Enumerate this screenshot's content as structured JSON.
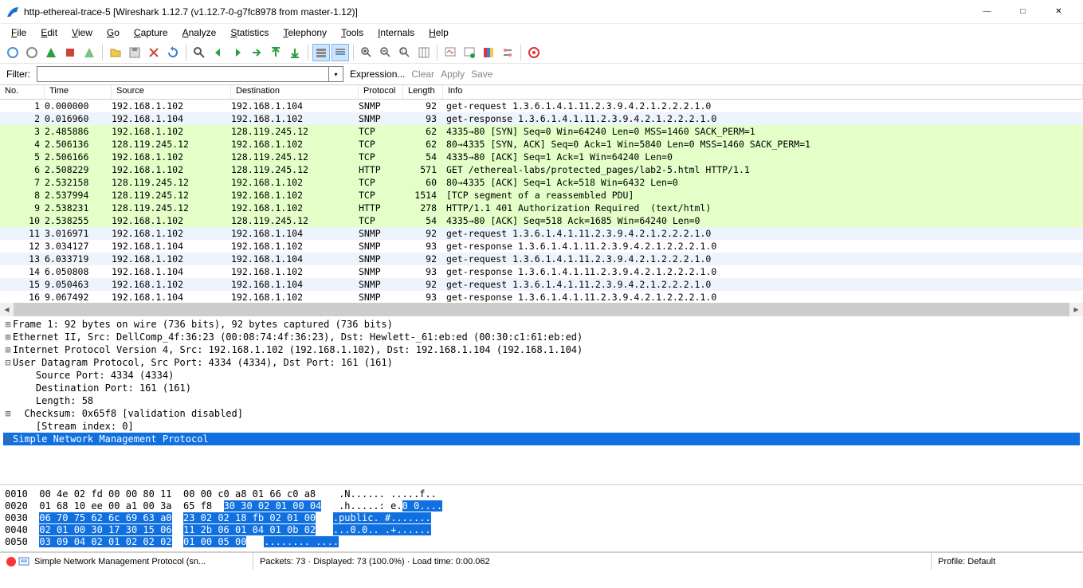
{
  "window": {
    "title": "http-ethereal-trace-5   [Wireshark 1.12.7  (v1.12.7-0-g7fc8978 from master-1.12)]"
  },
  "menu": {
    "items": [
      "File",
      "Edit",
      "View",
      "Go",
      "Capture",
      "Analyze",
      "Statistics",
      "Telephony",
      "Tools",
      "Internals",
      "Help"
    ]
  },
  "filter": {
    "label": "Filter:",
    "value": "",
    "expression": "Expression...",
    "clear": "Clear",
    "apply": "Apply",
    "save": "Save"
  },
  "columns": [
    "No.",
    "Time",
    "Source",
    "Destination",
    "Protocol",
    "Length",
    "Info"
  ],
  "packets": [
    {
      "no": "1",
      "time": "0.000000",
      "src": "192.168.1.102",
      "dst": "192.168.1.104",
      "proto": "SNMP",
      "len": "92",
      "info": "get-request 1.3.6.1.4.1.11.2.3.9.4.2.1.2.2.2.1.0",
      "cls": "snmp"
    },
    {
      "no": "2",
      "time": "0.016960",
      "src": "192.168.1.104",
      "dst": "192.168.1.102",
      "proto": "SNMP",
      "len": "93",
      "info": "get-response 1.3.6.1.4.1.11.2.3.9.4.2.1.2.2.2.1.0",
      "cls": "snmp alt"
    },
    {
      "no": "3",
      "time": "2.485886",
      "src": "192.168.1.102",
      "dst": "128.119.245.12",
      "proto": "TCP",
      "len": "62",
      "info": "4335→80 [SYN] Seq=0 Win=64240 Len=0 MSS=1460 SACK_PERM=1",
      "cls": "tcp"
    },
    {
      "no": "4",
      "time": "2.506136",
      "src": "128.119.245.12",
      "dst": "192.168.1.102",
      "proto": "TCP",
      "len": "62",
      "info": "80→4335 [SYN, ACK] Seq=0 Ack=1 Win=5840 Len=0 MSS=1460 SACK_PERM=1",
      "cls": "tcp"
    },
    {
      "no": "5",
      "time": "2.506166",
      "src": "192.168.1.102",
      "dst": "128.119.245.12",
      "proto": "TCP",
      "len": "54",
      "info": "4335→80 [ACK] Seq=1 Ack=1 Win=64240 Len=0",
      "cls": "tcp"
    },
    {
      "no": "6",
      "time": "2.508229",
      "src": "192.168.1.102",
      "dst": "128.119.245.12",
      "proto": "HTTP",
      "len": "571",
      "info": "GET /ethereal-labs/protected_pages/lab2-5.html HTTP/1.1",
      "cls": "http"
    },
    {
      "no": "7",
      "time": "2.532158",
      "src": "128.119.245.12",
      "dst": "192.168.1.102",
      "proto": "TCP",
      "len": "60",
      "info": "80→4335 [ACK] Seq=1 Ack=518 Win=6432 Len=0",
      "cls": "tcp"
    },
    {
      "no": "8",
      "time": "2.537994",
      "src": "128.119.245.12",
      "dst": "192.168.1.102",
      "proto": "TCP",
      "len": "1514",
      "info": "[TCP segment of a reassembled PDU]",
      "cls": "tcp"
    },
    {
      "no": "9",
      "time": "2.538231",
      "src": "128.119.245.12",
      "dst": "192.168.1.102",
      "proto": "HTTP",
      "len": "278",
      "info": "HTTP/1.1 401 Authorization Required  (text/html)",
      "cls": "http"
    },
    {
      "no": "10",
      "time": "2.538255",
      "src": "192.168.1.102",
      "dst": "128.119.245.12",
      "proto": "TCP",
      "len": "54",
      "info": "4335→80 [ACK] Seq=518 Ack=1685 Win=64240 Len=0",
      "cls": "tcp"
    },
    {
      "no": "11",
      "time": "3.016971",
      "src": "192.168.1.102",
      "dst": "192.168.1.104",
      "proto": "SNMP",
      "len": "92",
      "info": "get-request 1.3.6.1.4.1.11.2.3.9.4.2.1.2.2.2.1.0",
      "cls": "snmp alt"
    },
    {
      "no": "12",
      "time": "3.034127",
      "src": "192.168.1.104",
      "dst": "192.168.1.102",
      "proto": "SNMP",
      "len": "93",
      "info": "get-response 1.3.6.1.4.1.11.2.3.9.4.2.1.2.2.2.1.0",
      "cls": "snmp"
    },
    {
      "no": "13",
      "time": "6.033719",
      "src": "192.168.1.102",
      "dst": "192.168.1.104",
      "proto": "SNMP",
      "len": "92",
      "info": "get-request 1.3.6.1.4.1.11.2.3.9.4.2.1.2.2.2.1.0",
      "cls": "snmp alt"
    },
    {
      "no": "14",
      "time": "6.050808",
      "src": "192.168.1.104",
      "dst": "192.168.1.102",
      "proto": "SNMP",
      "len": "93",
      "info": "get-response 1.3.6.1.4.1.11.2.3.9.4.2.1.2.2.2.1.0",
      "cls": "snmp"
    },
    {
      "no": "15",
      "time": "9.050463",
      "src": "192.168.1.102",
      "dst": "192.168.1.104",
      "proto": "SNMP",
      "len": "92",
      "info": "get-request 1.3.6.1.4.1.11.2.3.9.4.2.1.2.2.2.1.0",
      "cls": "snmp alt"
    },
    {
      "no": "16",
      "time": "9.067492",
      "src": "192.168.1.104",
      "dst": "192.168.1.102",
      "proto": "SNMP",
      "len": "93",
      "info": "get-response 1.3.6.1.4.1.11.2.3.9.4.2.1.2.2.2.1.0",
      "cls": "snmp"
    }
  ],
  "details": [
    {
      "exp": "⊞",
      "indent": 0,
      "text": "Frame 1: 92 bytes on wire (736 bits), 92 bytes captured (736 bits)",
      "sel": false
    },
    {
      "exp": "⊞",
      "indent": 0,
      "text": "Ethernet II, Src: DellComp_4f:36:23 (00:08:74:4f:36:23), Dst: Hewlett-_61:eb:ed (00:30:c1:61:eb:ed)",
      "sel": false
    },
    {
      "exp": "⊞",
      "indent": 0,
      "text": "Internet Protocol Version 4, Src: 192.168.1.102 (192.168.1.102), Dst: 192.168.1.104 (192.168.1.104)",
      "sel": false
    },
    {
      "exp": "⊟",
      "indent": 0,
      "text": "User Datagram Protocol, Src Port: 4334 (4334), Dst Port: 161 (161)",
      "sel": false
    },
    {
      "exp": " ",
      "indent": 2,
      "text": "Source Port: 4334 (4334)",
      "sel": false
    },
    {
      "exp": " ",
      "indent": 2,
      "text": "Destination Port: 161 (161)",
      "sel": false
    },
    {
      "exp": " ",
      "indent": 2,
      "text": "Length: 58",
      "sel": false
    },
    {
      "exp": "⊞",
      "indent": 1,
      "text": "Checksum: 0x65f8 [validation disabled]",
      "sel": false
    },
    {
      "exp": " ",
      "indent": 2,
      "text": "[Stream index: 0]",
      "sel": false
    },
    {
      "exp": "⊞",
      "indent": 0,
      "text": "Simple Network Management Protocol",
      "sel": true
    }
  ],
  "hex": [
    {
      "off": "0010",
      "b1": "00 4e 02 fd 00 00 80 11",
      "b2": "00 00 c0 a8 01 66 c0 a8",
      "a": ".N...... .....f..",
      "sel1": "",
      "sel2": "",
      "asel": ""
    },
    {
      "off": "0020",
      "b1": "01 68 10 ee 00 a1 00 3a",
      "b2": "65 f8 ",
      "a": ".h.....: e.",
      "sel1": "",
      "sel2": "30 30 02 01 00 04",
      "asel": "0 0...."
    },
    {
      "off": "0030",
      "b1": "",
      "b2": "",
      "a": "",
      "sel1": "06 70 75 62 6c 69 63 a0",
      "sel2": "23 02 02 18 fb 02 01 00",
      "asel": ".public. #......."
    },
    {
      "off": "0040",
      "b1": "",
      "b2": "",
      "a": "",
      "sel1": "02 01 00 30 17 30 15 06",
      "sel2": "11 2b 06 01 04 01 0b 02",
      "asel": "...0.0.. .+......"
    },
    {
      "off": "0050",
      "b1": "",
      "b2": "",
      "a": "",
      "sel1": "03 09 04 02 01 02 02 02",
      "sel2": "01 00 05 00",
      "asel": "........ ...."
    }
  ],
  "status": {
    "field": "Simple Network Management Protocol (sn...",
    "packets": "Packets: 73 · Displayed: 73 (100.0%) · Load time: 0:00.062",
    "profile": "Profile: Default"
  }
}
